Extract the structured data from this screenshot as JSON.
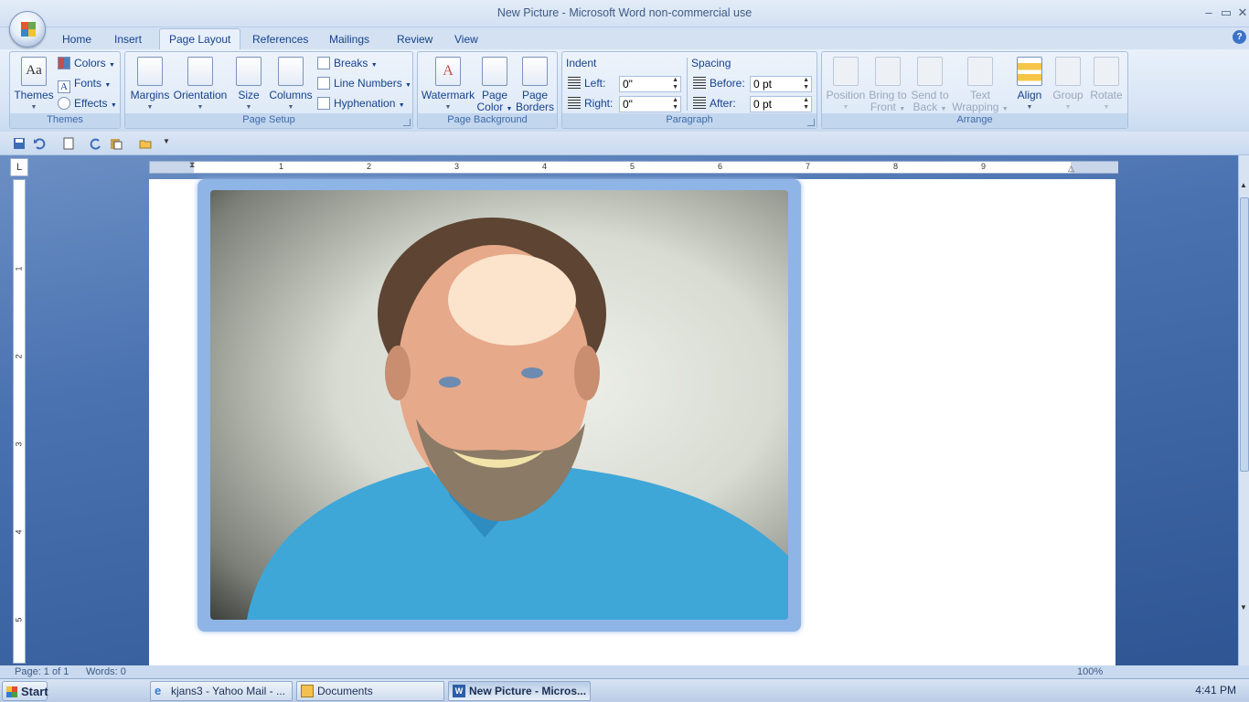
{
  "window": {
    "title": "New Picture - Microsoft Word non-commercial use",
    "minimize": "–",
    "maximize": "▭",
    "close": "✕"
  },
  "tabs": [
    {
      "label": "Home"
    },
    {
      "label": "Insert"
    },
    {
      "label": "Page Layout",
      "active": true
    },
    {
      "label": "References"
    },
    {
      "label": "Mailings"
    },
    {
      "label": "Review"
    },
    {
      "label": "View"
    }
  ],
  "help": "?",
  "ribbon": {
    "themes": {
      "group": "Themes",
      "themes_btn": "Themes",
      "colors": "Colors",
      "fonts": "Fonts",
      "effects": "Effects"
    },
    "page_setup": {
      "group": "Page Setup",
      "margins": "Margins",
      "orientation": "Orientation",
      "size": "Size",
      "columns": "Columns",
      "breaks": "Breaks",
      "line_numbers": "Line Numbers",
      "hyphenation": "Hyphenation"
    },
    "page_background": {
      "group": "Page Background",
      "watermark": "Watermark",
      "page_color_1": "Page",
      "page_color_2": "Color",
      "page_borders_1": "Page",
      "page_borders_2": "Borders"
    },
    "paragraph": {
      "group": "Paragraph",
      "indent": "Indent",
      "left_label": "Left:",
      "left_value": "0\"",
      "right_label": "Right:",
      "right_value": "0\"",
      "spacing": "Spacing",
      "before_label": "Before:",
      "before_value": "0 pt",
      "after_label": "After:",
      "after_value": "0 pt"
    },
    "arrange": {
      "group": "Arrange",
      "position": "Position",
      "bring_1": "Bring to",
      "bring_2": "Front",
      "send_1": "Send to",
      "send_2": "Back",
      "wrap_1": "Text",
      "wrap_2": "Wrapping",
      "align": "Align",
      "group_btn": "Group",
      "rotate": "Rotate"
    }
  },
  "ruler": {
    "h_numbers": [
      "1",
      "2",
      "3",
      "4",
      "5",
      "6",
      "7",
      "8",
      "9"
    ],
    "v_numbers": [
      "1",
      "2",
      "3",
      "4",
      "5"
    ],
    "corner": "L"
  },
  "status": {
    "page": "Page: 1 of 1",
    "words": "Words: 0",
    "zoom": "100%"
  },
  "taskbar": {
    "start": "Start",
    "items": [
      {
        "label": "kjans3 - Yahoo Mail - ..."
      },
      {
        "label": "Documents"
      },
      {
        "label": "New Picture - Micros...",
        "active": true
      }
    ],
    "clock": "4:41 PM"
  }
}
